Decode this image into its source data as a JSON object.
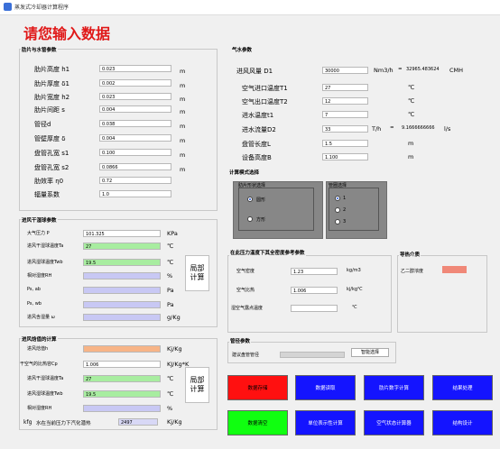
{
  "window": {
    "title": "蒸发式冷却器计算程序"
  },
  "heading": "请您输入数据",
  "fin": {
    "title": "肋片与水管参数",
    "rows": [
      {
        "label": "肋片高度 h1",
        "value": "0.023",
        "unit": "m"
      },
      {
        "label": "肋片厚度 δ1",
        "value": "0.002",
        "unit": "m"
      },
      {
        "label": "肋片宽度 h2",
        "value": "0.023",
        "unit": "m"
      },
      {
        "label": "肋片间距 s",
        "value": "0.004",
        "unit": "m"
      },
      {
        "label": "管径d",
        "value": "0.038",
        "unit": "m"
      },
      {
        "label": "管壁厚度 δ",
        "value": "0.004",
        "unit": "m"
      },
      {
        "label": "盘管孔宽 s1",
        "value": "0.100",
        "unit": "m"
      },
      {
        "label": "盘管孔宽 s2",
        "value": "0.0866",
        "unit": "m"
      },
      {
        "label": "肋效率 η0",
        "value": "0.72",
        "unit": ""
      },
      {
        "label": "辐量系数",
        "value": "1.0",
        "unit": ""
      }
    ]
  },
  "inletAir": {
    "title": "进风干湿球参数",
    "rows": [
      {
        "label": "大气压力 P",
        "value": "101.325",
        "unit": "KPa"
      },
      {
        "label": "进风干湿球温度Ta",
        "value": "27",
        "unit": "℃"
      },
      {
        "label": "进风湿球温度Twb",
        "value": "19.5",
        "unit": "℃"
      },
      {
        "label": "相对湿度RH",
        "value": "",
        "unit": "%"
      },
      {
        "label": "Ps, ab",
        "value": "",
        "unit": "Pa"
      },
      {
        "label": "Ps, wb",
        "value": "",
        "unit": "Pa"
      },
      {
        "label": "进风含湿量 ω",
        "value": "",
        "unit": "g/Kg"
      }
    ],
    "calc_label": "局部\n计算"
  },
  "enthalpy": {
    "title": "进风焓值的计算",
    "rows": [
      {
        "label": "进风焓值h",
        "value": "",
        "unit": "Kj/Kg"
      },
      {
        "label": "干空气的比热容Cp",
        "value": "1.006",
        "unit": "KJ/Kg*K"
      },
      {
        "label": "进风干湿球温度Ta",
        "value": "27",
        "unit": "℃"
      },
      {
        "label": "进风湿球温度Twb",
        "value": "19.5",
        "unit": "℃"
      },
      {
        "label": "相对湿度RH",
        "value": "",
        "unit": "%"
      }
    ],
    "last_prefix": "kfg",
    "last_label": "水在当前压力下汽化潜热",
    "last_value": "2497",
    "last_unit": "Kj/Kg",
    "calc_label": "局部\n计算"
  },
  "airParams": {
    "title": "气水参数",
    "rows": [
      {
        "label": "进风风量 D1",
        "value": "30000",
        "unit": "Nm3/h",
        "eq": "=",
        "extra": "32965.483624",
        "extra_unit": "CMH"
      },
      {
        "label": "空气进口温度T1",
        "value": "27",
        "unit": "℃"
      },
      {
        "label": "空气出口温度T2",
        "value": "12",
        "unit": "℃"
      },
      {
        "label": "进水温度t1",
        "value": "7",
        "unit": "℃"
      },
      {
        "label": "进水流量D2",
        "value": "33",
        "unit": "T/h",
        "eq": "=",
        "extra": "9.1666666666",
        "extra_unit": "l/s"
      },
      {
        "label": "盘管长度L",
        "value": "1.5",
        "unit": "m"
      },
      {
        "label": "设备高度B",
        "value": "1.100",
        "unit": "m"
      }
    ]
  },
  "calcMode": {
    "title": "计算模式选择",
    "shape": {
      "title": "肋片形状选择",
      "options": [
        "圆形",
        "方形"
      ],
      "selected": 0
    },
    "tubes": {
      "title": "管圈选择",
      "options": [
        "1",
        "2",
        "3"
      ],
      "selected": 0
    }
  },
  "reference": {
    "title": "在此压力温度下其全密度参考参数",
    "rows": [
      {
        "label": "空气密度",
        "value": "1.23",
        "unit": "kg/m3"
      },
      {
        "label": "空气比热",
        "value": "1.006",
        "unit": "kj/kg℃"
      },
      {
        "label": "湿空气露点温度",
        "value": "",
        "unit": "℃"
      }
    ]
  },
  "thermal": {
    "title": "导热介质",
    "label": "乙二醇浓度",
    "swatch_color": "#f08878"
  },
  "tubeSelect": {
    "title": "管径参数",
    "label": "建议盘管管径",
    "button": "智能选择"
  },
  "actions": {
    "row1": [
      "数据存储",
      "数据读取",
      "肋片数字计算",
      "结果处理"
    ],
    "row2": [
      "数据清空",
      "单位表示性计算",
      "空气状态计算器",
      "结构设计"
    ]
  },
  "colors": {
    "heading": "#e01818",
    "blue": "#1414ff",
    "red": "#ff1010",
    "green": "#10ff10",
    "green_field": "#a8eda0",
    "lav_field": "#c8c8f4",
    "orange_field": "#f7b487"
  }
}
